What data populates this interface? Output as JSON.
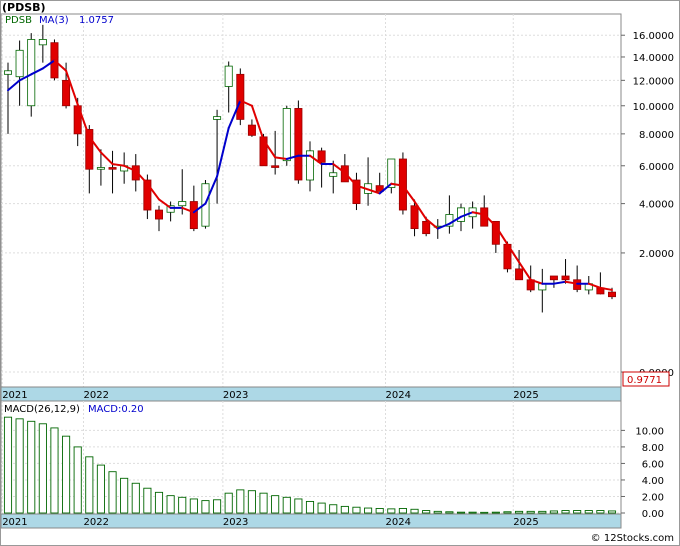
{
  "title": "(PDSB)",
  "legend": {
    "symbol": "PDSB",
    "ma_label": "MA(3)",
    "ma_value": "1.0757"
  },
  "price_axis_labels": [
    "16.0000",
    "14.0000",
    "12.0000",
    "10.0000",
    "8.0000",
    "6.0000",
    "4.0000",
    "2.0000",
    "0.0000"
  ],
  "last_price": "0.9771",
  "x_axis_labels": [
    "2021",
    "2022",
    "2023",
    "2024",
    "2025"
  ],
  "macd": {
    "label": "MACD(26,12,9)",
    "value_label": "MACD:0.20",
    "axis_labels": [
      "10.00",
      "8.00",
      "6.00",
      "4.00",
      "2.00",
      "0.00"
    ]
  },
  "watermark": "© 12Stocks.com",
  "colors": {
    "up_candle": "#ffffff",
    "down_candle": "#e00000",
    "ma_line_up": "#0000cc",
    "ma_line_down": "#e00000",
    "macd_bar": "#006600",
    "axis_band": "#add8e6",
    "last_price_box": "#cc0000"
  },
  "chart_data": [
    {
      "type": "candlestick",
      "series_name": "PDSB",
      "scale": "sqrt",
      "ylim": [
        0,
        16.5
      ],
      "yticks": [
        16,
        14,
        12,
        10,
        8,
        6,
        4,
        2,
        0
      ],
      "candles": [
        {
          "o": 12.5,
          "h": 13.5,
          "l": 8.0,
          "c": 12.8,
          "t": "2021"
        },
        {
          "o": 12.3,
          "h": 15.5,
          "l": 10.0,
          "c": 14.6
        },
        {
          "o": 10.0,
          "h": 16.2,
          "l": 9.2,
          "c": 15.6
        },
        {
          "o": 15.1,
          "h": 17.0,
          "l": 13.5,
          "c": 15.6
        },
        {
          "o": 15.3,
          "h": 15.6,
          "l": 12.0,
          "c": 12.2
        },
        {
          "o": 12.0,
          "h": 13.5,
          "l": 9.8,
          "c": 10.0
        },
        {
          "o": 10.0,
          "h": 10.6,
          "l": 7.2,
          "c": 8.0
        },
        {
          "o": 8.3,
          "h": 8.6,
          "l": 4.5,
          "c": 5.8,
          "t": "2022"
        },
        {
          "o": 5.8,
          "h": 7.0,
          "l": 4.9,
          "c": 5.9
        },
        {
          "o": 5.9,
          "h": 6.9,
          "l": 4.5,
          "c": 5.8
        },
        {
          "o": 5.7,
          "h": 6.8,
          "l": 5.0,
          "c": 6.0
        },
        {
          "o": 6.0,
          "h": 6.7,
          "l": 4.6,
          "c": 5.2
        },
        {
          "o": 5.2,
          "h": 5.5,
          "l": 3.3,
          "c": 3.7
        },
        {
          "o": 3.7,
          "h": 3.9,
          "l": 2.8,
          "c": 3.3
        },
        {
          "o": 3.6,
          "h": 4.1,
          "l": 3.2,
          "c": 3.9
        },
        {
          "o": 3.9,
          "h": 5.8,
          "l": 3.5,
          "c": 4.1
        },
        {
          "o": 4.1,
          "h": 4.9,
          "l": 2.8,
          "c": 2.9
        },
        {
          "o": 3.0,
          "h": 5.2,
          "l": 2.9,
          "c": 5.0
        },
        {
          "o": 9.0,
          "h": 9.7,
          "l": 4.0,
          "c": 9.2
        },
        {
          "o": 11.5,
          "h": 13.6,
          "l": 9.5,
          "c": 13.2,
          "t": "2023"
        },
        {
          "o": 12.5,
          "h": 13.0,
          "l": 8.6,
          "c": 9.0
        },
        {
          "o": 8.6,
          "h": 9.0,
          "l": 7.8,
          "c": 7.9
        },
        {
          "o": 7.8,
          "h": 8.0,
          "l": 6.0,
          "c": 6.0
        },
        {
          "o": 6.0,
          "h": 8.2,
          "l": 5.5,
          "c": 5.9
        },
        {
          "o": 6.3,
          "h": 10.0,
          "l": 6.0,
          "c": 9.8
        },
        {
          "o": 9.8,
          "h": 10.4,
          "l": 5.0,
          "c": 5.2
        },
        {
          "o": 5.2,
          "h": 7.5,
          "l": 4.6,
          "c": 6.9
        },
        {
          "o": 6.9,
          "h": 7.1,
          "l": 4.8,
          "c": 6.2
        },
        {
          "o": 5.4,
          "h": 6.3,
          "l": 4.5,
          "c": 5.6
        },
        {
          "o": 6.0,
          "h": 6.7,
          "l": 5.2,
          "c": 5.1
        },
        {
          "o": 5.2,
          "h": 5.6,
          "l": 3.7,
          "c": 4.0
        },
        {
          "o": 4.5,
          "h": 6.5,
          "l": 3.9,
          "c": 5.0
        },
        {
          "o": 4.9,
          "h": 5.6,
          "l": 4.6,
          "c": 4.6
        },
        {
          "o": 4.8,
          "h": 6.3,
          "l": 4.5,
          "c": 6.4,
          "t": "2024"
        },
        {
          "o": 6.4,
          "h": 6.8,
          "l": 3.5,
          "c": 3.7
        },
        {
          "o": 3.9,
          "h": 4.2,
          "l": 2.6,
          "c": 2.9
        },
        {
          "o": 3.2,
          "h": 3.4,
          "l": 2.6,
          "c": 2.7
        },
        {
          "o": 3.0,
          "h": 3.3,
          "l": 2.5,
          "c": 3.0
        },
        {
          "o": 3.0,
          "h": 4.4,
          "l": 2.7,
          "c": 3.5
        },
        {
          "o": 3.2,
          "h": 4.0,
          "l": 2.8,
          "c": 3.8
        },
        {
          "o": 3.4,
          "h": 4.1,
          "l": 2.9,
          "c": 3.8
        },
        {
          "o": 3.8,
          "h": 4.4,
          "l": 3.0,
          "c": 3.0
        },
        {
          "o": 3.2,
          "h": 3.2,
          "l": 2.0,
          "c": 2.3
        },
        {
          "o": 2.3,
          "h": 2.4,
          "l": 1.4,
          "c": 1.5
        },
        {
          "o": 1.5,
          "h": 2.1,
          "l": 1.2,
          "c": 1.2,
          "t": "2025"
        },
        {
          "o": 1.2,
          "h": 1.6,
          "l": 0.9,
          "c": 0.95
        },
        {
          "o": 0.95,
          "h": 1.5,
          "l": 0.5,
          "c": 1.1
        },
        {
          "o": 1.3,
          "h": 1.3,
          "l": 1.0,
          "c": 1.2
        },
        {
          "o": 1.3,
          "h": 1.8,
          "l": 1.1,
          "c": 1.2
        },
        {
          "o": 1.2,
          "h": 1.6,
          "l": 0.9,
          "c": 0.96
        },
        {
          "o": 0.95,
          "h": 1.3,
          "l": 0.85,
          "c": 1.1
        },
        {
          "o": 1.0,
          "h": 1.4,
          "l": 0.85,
          "c": 0.86
        },
        {
          "o": 0.9,
          "h": 1.0,
          "l": 0.75,
          "c": 0.8
        }
      ],
      "ma3": [
        11.2,
        12.0,
        12.5,
        13.0,
        13.7,
        12.8,
        10.1,
        7.8,
        6.8,
        6.1,
        6.0,
        5.7,
        5.0,
        4.2,
        3.8,
        3.8,
        3.6,
        4.0,
        5.4,
        8.4,
        10.4,
        10.0,
        7.6,
        6.5,
        6.4,
        6.6,
        6.6,
        6.1,
        6.1,
        5.6,
        4.9,
        4.7,
        4.5,
        5.0,
        4.9,
        4.1,
        3.3,
        2.9,
        3.1,
        3.4,
        3.6,
        3.5,
        3.0,
        2.3,
        1.7,
        1.2,
        1.1,
        1.1,
        1.15,
        1.1,
        1.1,
        1.0,
        0.95
      ],
      "last_value": 0.9771
    },
    {
      "type": "bar",
      "series_name": "MACD(26,12,9)",
      "ylim": [
        0,
        11.5
      ],
      "yticks": [
        10,
        8,
        6,
        4,
        2,
        0
      ],
      "values": [
        11.6,
        11.4,
        11.1,
        10.8,
        10.3,
        9.3,
        8.0,
        6.8,
        5.8,
        5.0,
        4.2,
        3.6,
        3.0,
        2.5,
        2.1,
        1.9,
        1.7,
        1.5,
        1.6,
        2.4,
        2.8,
        2.7,
        2.4,
        2.1,
        1.9,
        1.7,
        1.4,
        1.2,
        1.0,
        0.8,
        0.7,
        0.6,
        0.55,
        0.5,
        0.55,
        0.45,
        0.3,
        0.2,
        0.15,
        0.1,
        0.1,
        0.08,
        0.1,
        0.15,
        0.2,
        0.2,
        0.2,
        0.25,
        0.3,
        0.3,
        0.3,
        0.3,
        0.25
      ]
    }
  ]
}
